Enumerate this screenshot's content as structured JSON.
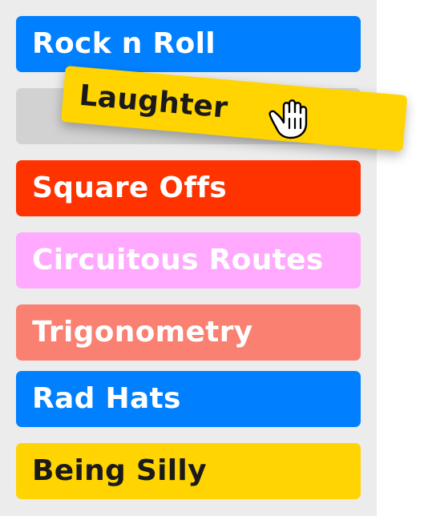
{
  "list": {
    "items": [
      {
        "label": "Rock n Roll",
        "color": "#0080ff",
        "text_color": "#ffffff"
      },
      {
        "label": "Square Offs",
        "color": "#ff3300",
        "text_color": "#ffffff"
      },
      {
        "label": "Circuitous Routes",
        "color": "#ffaaff",
        "text_color": "#ffffff"
      },
      {
        "label": "Trigonometry",
        "color": "#fa8072",
        "text_color": "#ffffff"
      },
      {
        "label": "Rad Hats",
        "color": "#0080ff",
        "text_color": "#ffffff"
      },
      {
        "label": "Being Silly",
        "color": "#ffd400",
        "text_color": "#1a1a1a"
      }
    ]
  },
  "drag": {
    "label": "Laughter",
    "color": "#ffd400",
    "cursor_icon": "grab-hand-icon"
  }
}
